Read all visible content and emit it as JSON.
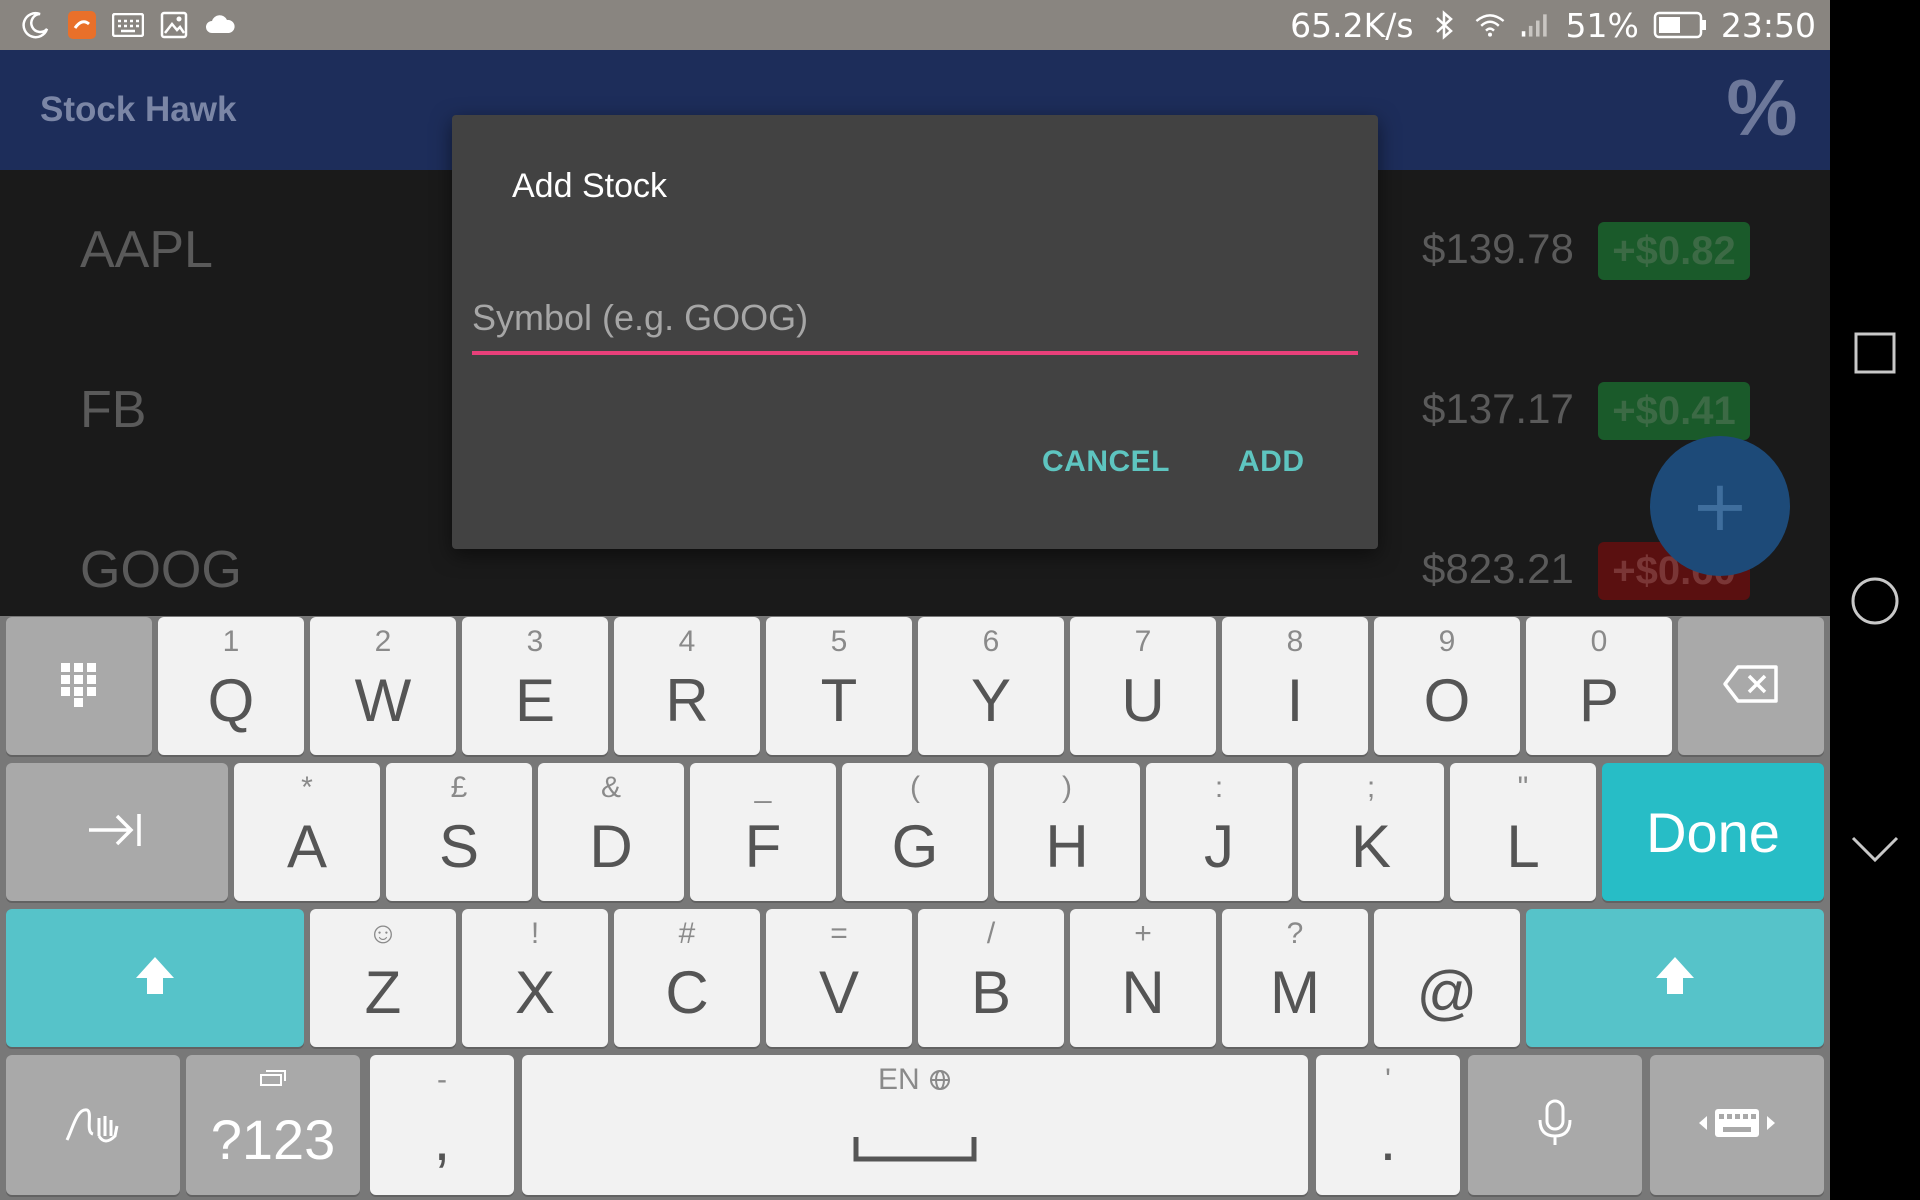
{
  "status_bar": {
    "net_speed": "65.2K/s",
    "battery": "51%",
    "time": "23:50",
    "left_icons": [
      "moon-icon",
      "app-notification-icon",
      "keyboard-icon",
      "image-icon",
      "cloud-icon"
    ],
    "right_icons": [
      "bluetooth-icon",
      "wifi-icon",
      "signal-icon",
      "battery-icon"
    ]
  },
  "app_bar": {
    "title": "Stock Hawk",
    "percent_label": "%"
  },
  "stocks": [
    {
      "symbol": "AAPL",
      "price": "$139.78",
      "change": "+$0.82",
      "change_color": "#1a5a2a"
    },
    {
      "symbol": "FB",
      "price": "$137.17",
      "change": "+$0.41",
      "change_color": "#1a5a2a"
    },
    {
      "symbol": "GOOG",
      "price": "$823.21",
      "change": "+$0.60",
      "change_color": "#5a1010"
    }
  ],
  "fab_label": "+",
  "dialog": {
    "title": "Add Stock",
    "input_placeholder": "Symbol (e.g. GOOG)",
    "input_value": "",
    "cancel_label": "CANCEL",
    "add_label": "ADD",
    "accent_color": "#e8407a",
    "button_color": "#5ec5c0"
  },
  "keyboard": {
    "row1": [
      {
        "main": "Q",
        "sub": "1"
      },
      {
        "main": "W",
        "sub": "2"
      },
      {
        "main": "E",
        "sub": "3"
      },
      {
        "main": "R",
        "sub": "4"
      },
      {
        "main": "T",
        "sub": "5"
      },
      {
        "main": "Y",
        "sub": "6"
      },
      {
        "main": "U",
        "sub": "7"
      },
      {
        "main": "I",
        "sub": "8"
      },
      {
        "main": "O",
        "sub": "9"
      },
      {
        "main": "P",
        "sub": "0"
      }
    ],
    "row2": [
      {
        "main": "A",
        "sub": "*"
      },
      {
        "main": "S",
        "sub": "£"
      },
      {
        "main": "D",
        "sub": "&"
      },
      {
        "main": "F",
        "sub": "_"
      },
      {
        "main": "G",
        "sub": "("
      },
      {
        "main": "H",
        "sub": ")"
      },
      {
        "main": "J",
        "sub": ":"
      },
      {
        "main": "K",
        "sub": ";"
      },
      {
        "main": "L",
        "sub": "\""
      }
    ],
    "row3": [
      {
        "main": "Z",
        "sub": "☺"
      },
      {
        "main": "X",
        "sub": "!"
      },
      {
        "main": "C",
        "sub": "#"
      },
      {
        "main": "V",
        "sub": "="
      },
      {
        "main": "B",
        "sub": "/"
      },
      {
        "main": "N",
        "sub": "+"
      },
      {
        "main": "M",
        "sub": "?"
      },
      {
        "main": "@",
        "sub": ""
      }
    ],
    "done_label": "Done",
    "symbols_label": "?123",
    "comma_main": ",",
    "comma_sub": "-",
    "period_main": ".",
    "period_sub": "'",
    "space_language": "EN",
    "accent_color": "#27bdc6"
  }
}
